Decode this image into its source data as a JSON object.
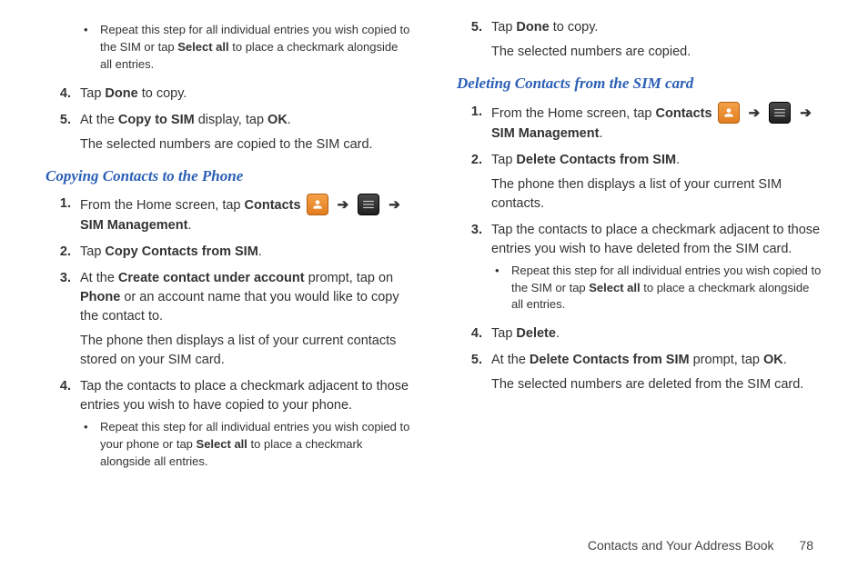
{
  "col1": {
    "top_bullet": {
      "pre": "Repeat this step for all individual entries you wish copied to the SIM or tap ",
      "bold": "Select all",
      "post": " to place a checkmark alongside all entries."
    },
    "step4": {
      "num": "4.",
      "pre": "Tap ",
      "bold": "Done",
      "post": " to copy."
    },
    "step5": {
      "num": "5.",
      "pre": "At the ",
      "bold": "Copy to SIM",
      "mid": " display, tap ",
      "bold2": "OK",
      "post": ".",
      "sub": "The selected numbers are copied to the SIM card."
    },
    "heading": "Copying Contacts to the Phone",
    "s1": {
      "num": "1.",
      "pre": "From the Home screen, tap ",
      "bold1": "Contacts",
      "arrow": "➔",
      "arrow2": "➔",
      "bold2": "SIM Management",
      "post": "."
    },
    "s2": {
      "num": "2.",
      "pre": "Tap ",
      "bold": "Copy Contacts from SIM",
      "post": "."
    },
    "s3": {
      "num": "3.",
      "pre": "At the ",
      "bold1": "Create contact under account",
      "mid": " prompt, tap on ",
      "bold2": "Phone",
      "post": " or an account name that you would like to copy the contact to.",
      "sub": "The phone then displays a list of your current contacts stored on your SIM card."
    },
    "s4": {
      "num": "4.",
      "text": "Tap the contacts to place a checkmark adjacent to those entries you wish to have copied to your phone.",
      "bullet_pre": "Repeat this step for all individual entries you wish copied to your phone or tap ",
      "bullet_bold": "Select all",
      "bullet_post": " to place a checkmark alongside all entries."
    }
  },
  "col2": {
    "step5": {
      "num": "5.",
      "pre": "Tap ",
      "bold": "Done",
      "post": " to copy.",
      "sub": "The selected numbers are copied."
    },
    "heading": "Deleting Contacts from the SIM card",
    "s1": {
      "num": "1.",
      "pre": "From the Home screen, tap ",
      "bold1": "Contacts",
      "arrow": "➔",
      "arrow2": "➔",
      "bold2": "SIM Management",
      "post": "."
    },
    "s2": {
      "num": "2.",
      "pre": "Tap ",
      "bold": "Delete Contacts from SIM",
      "post": ".",
      "sub": "The phone then displays a list of your current SIM contacts."
    },
    "s3": {
      "num": "3.",
      "text": "Tap the contacts to place a checkmark adjacent to those entries you wish to have deleted from the SIM card.",
      "bullet_pre": "Repeat this step for all individual entries you wish copied to the SIM or tap ",
      "bullet_bold": "Select all",
      "bullet_post": " to place a checkmark alongside all entries."
    },
    "s4": {
      "num": "4.",
      "pre": "Tap ",
      "bold": "Delete",
      "post": "."
    },
    "s5": {
      "num": "5.",
      "pre": "At the ",
      "bold1": "Delete Contacts from SIM",
      "mid": " prompt, tap ",
      "bold2": "OK",
      "post": ".",
      "sub": "The selected numbers are deleted from the SIM card."
    }
  },
  "footer": {
    "section": "Contacts and Your Address Book",
    "page": "78"
  }
}
